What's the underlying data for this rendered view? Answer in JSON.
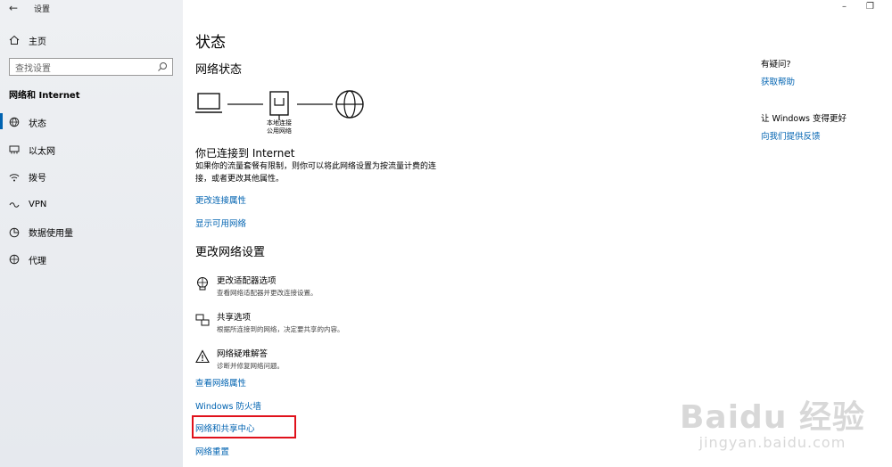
{
  "window": {
    "title": "设置",
    "minimize": "–",
    "maximize": "❐"
  },
  "sidebar": {
    "home": "主页",
    "search_placeholder": "查找设置",
    "section": "网络和 Internet",
    "items": [
      {
        "label": "状态",
        "icon": "globe-icon",
        "active": true
      },
      {
        "label": "以太网",
        "icon": "ethernet-icon"
      },
      {
        "label": "拨号",
        "icon": "dialup-icon"
      },
      {
        "label": "VPN",
        "icon": "vpn-icon"
      },
      {
        "label": "数据使用量",
        "icon": "data-usage-icon"
      },
      {
        "label": "代理",
        "icon": "proxy-icon"
      }
    ]
  },
  "main": {
    "title": "状态",
    "network_status": "网络状态",
    "diagram": {
      "connection_name": "本地连接",
      "network_type": "公用网络"
    },
    "connected_title": "你已连接到 Internet",
    "connected_desc": "如果你的流量套餐有限制，则你可以将此网络设置为按流量计费的连接，或者更改其他属性。",
    "link_change_props": "更改连接属性",
    "link_show_networks": "显示可用网络",
    "change_settings": "更改网络设置",
    "options": [
      {
        "title": "更改适配器选项",
        "desc": "查看网络适配器并更改连接设置。",
        "icon": "adapter-icon"
      },
      {
        "title": "共享选项",
        "desc": "根据所连接到的网络，决定要共享的内容。",
        "icon": "sharing-icon"
      },
      {
        "title": "网络疑难解答",
        "desc": "诊断并修复网络问题。",
        "icon": "warning-icon"
      }
    ],
    "link_view_props": "查看网络属性",
    "link_firewall": "Windows 防火墙",
    "link_sharing_center": "网络和共享中心",
    "link_reset": "网络重置"
  },
  "side_panel": {
    "q1": "有疑问?",
    "a1": "获取帮助",
    "q2": "让 Windows 变得更好",
    "a2": "向我们提供反馈"
  },
  "watermark": {
    "brand": "Baidu 经验",
    "url": "jingyan.baidu.com"
  }
}
